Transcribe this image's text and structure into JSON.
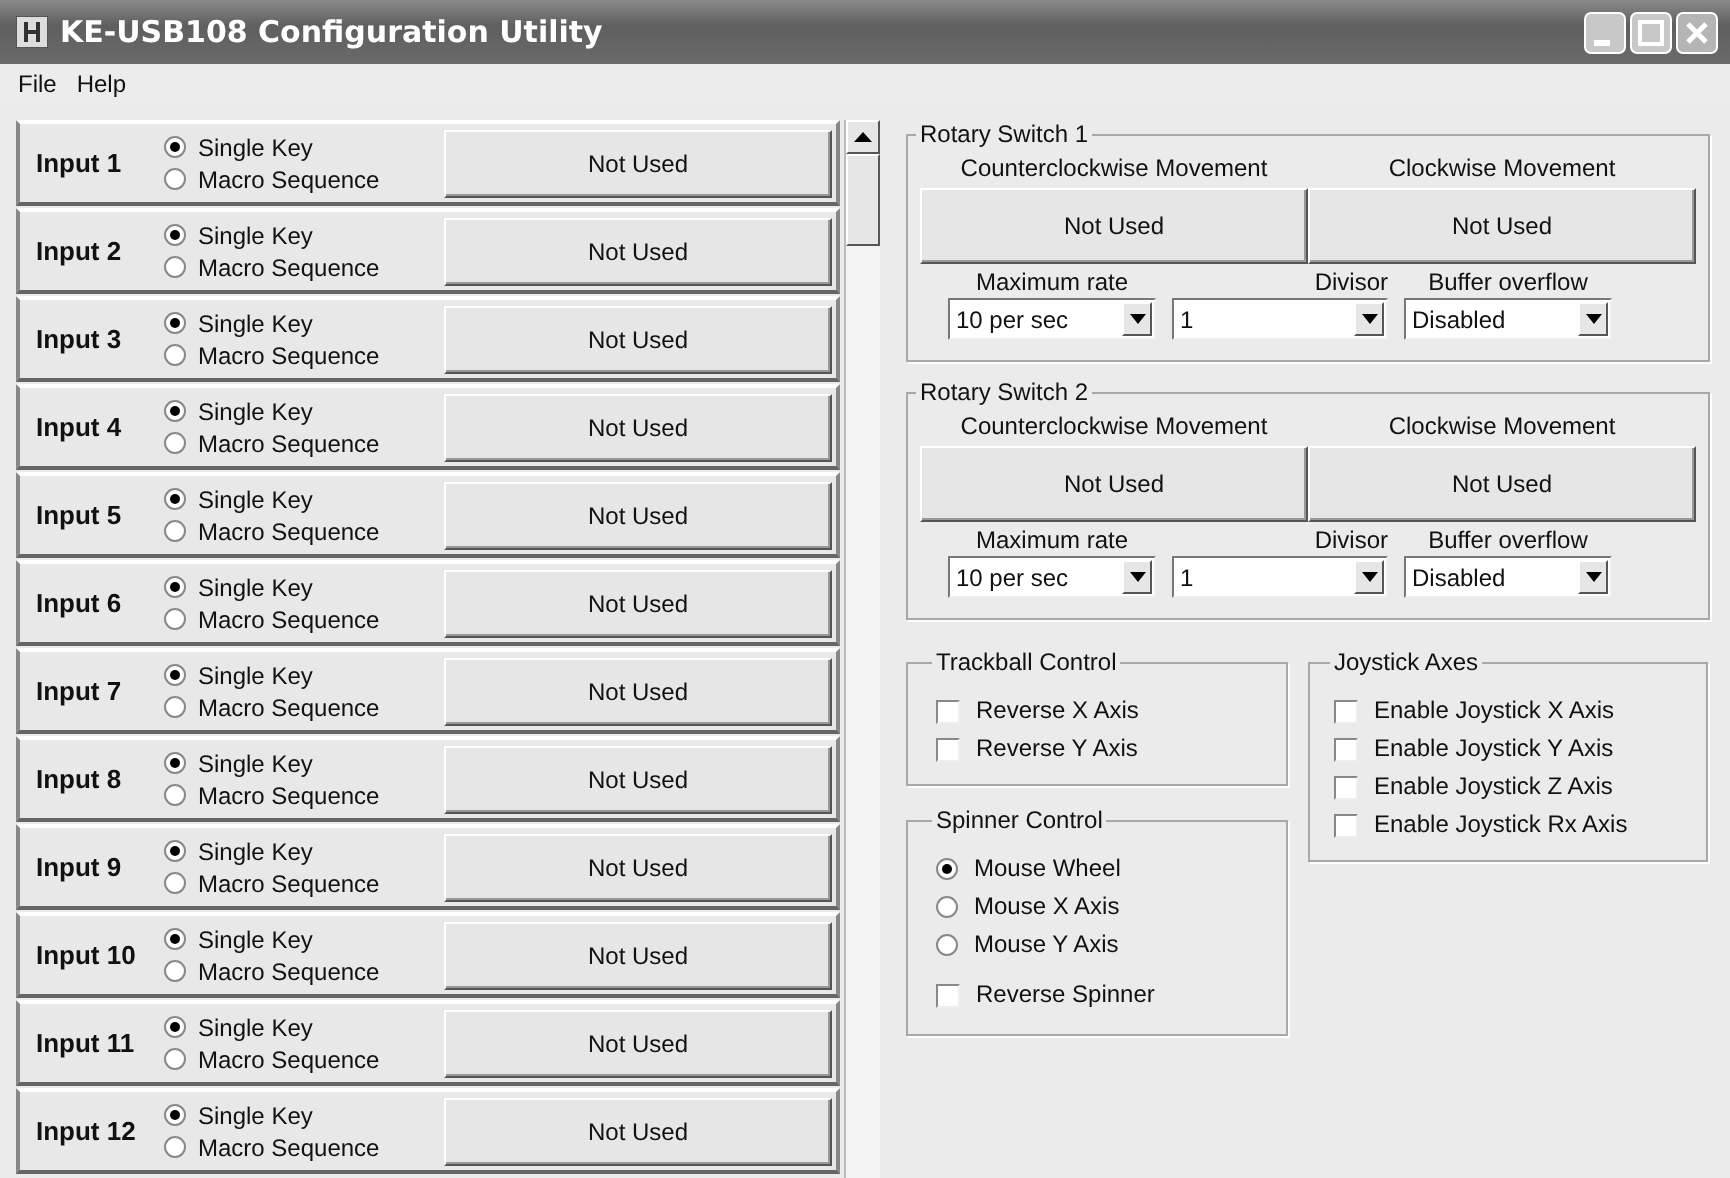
{
  "window": {
    "title": "KE-USB108 Configuration Utility"
  },
  "menu": [
    "File",
    "Help"
  ],
  "inputs": [
    {
      "label": "Input 1",
      "options": [
        {
          "label": "Single Key",
          "selected": true
        },
        {
          "label": "Macro Sequence",
          "selected": false
        }
      ],
      "action": "Not Used"
    },
    {
      "label": "Input 2",
      "options": [
        {
          "label": "Single Key",
          "selected": true
        },
        {
          "label": "Macro Sequence",
          "selected": false
        }
      ],
      "action": "Not Used"
    },
    {
      "label": "Input 3",
      "options": [
        {
          "label": "Single Key",
          "selected": true
        },
        {
          "label": "Macro Sequence",
          "selected": false
        }
      ],
      "action": "Not Used"
    },
    {
      "label": "Input 4",
      "options": [
        {
          "label": "Single Key",
          "selected": true
        },
        {
          "label": "Macro Sequence",
          "selected": false
        }
      ],
      "action": "Not Used"
    },
    {
      "label": "Input 5",
      "options": [
        {
          "label": "Single Key",
          "selected": true
        },
        {
          "label": "Macro Sequence",
          "selected": false
        }
      ],
      "action": "Not Used"
    },
    {
      "label": "Input 6",
      "options": [
        {
          "label": "Single Key",
          "selected": true
        },
        {
          "label": "Macro Sequence",
          "selected": false
        }
      ],
      "action": "Not Used"
    },
    {
      "label": "Input 7",
      "options": [
        {
          "label": "Single Key",
          "selected": true
        },
        {
          "label": "Macro Sequence",
          "selected": false
        }
      ],
      "action": "Not Used"
    },
    {
      "label": "Input 8",
      "options": [
        {
          "label": "Single Key",
          "selected": true
        },
        {
          "label": "Macro Sequence",
          "selected": false
        }
      ],
      "action": "Not Used"
    },
    {
      "label": "Input 9",
      "options": [
        {
          "label": "Single Key",
          "selected": true
        },
        {
          "label": "Macro Sequence",
          "selected": false
        }
      ],
      "action": "Not Used"
    },
    {
      "label": "Input 10",
      "options": [
        {
          "label": "Single Key",
          "selected": true
        },
        {
          "label": "Macro Sequence",
          "selected": false
        }
      ],
      "action": "Not Used"
    },
    {
      "label": "Input 11",
      "options": [
        {
          "label": "Single Key",
          "selected": true
        },
        {
          "label": "Macro Sequence",
          "selected": false
        }
      ],
      "action": "Not Used"
    },
    {
      "label": "Input 12",
      "options": [
        {
          "label": "Single Key",
          "selected": true
        },
        {
          "label": "Macro Sequence",
          "selected": false
        }
      ],
      "action": "Not Used"
    }
  ],
  "rotary_switches": [
    {
      "title": "Rotary Switch 1",
      "movements": [
        {
          "label": "Counterclockwise Movement",
          "value": "Not Used"
        },
        {
          "label": "Clockwise Movement",
          "value": "Not Used"
        }
      ],
      "dropdowns": [
        {
          "label": "Maximum rate",
          "value": "10 per sec"
        },
        {
          "label": "Divisor",
          "value": "1"
        },
        {
          "label": "Buffer overflow",
          "value": "Disabled"
        }
      ]
    },
    {
      "title": "Rotary Switch 2",
      "movements": [
        {
          "label": "Counterclockwise Movement",
          "value": "Not Used"
        },
        {
          "label": "Clockwise Movement",
          "value": "Not Used"
        }
      ],
      "dropdowns": [
        {
          "label": "Maximum rate",
          "value": "10 per sec"
        },
        {
          "label": "Divisor",
          "value": "1"
        },
        {
          "label": "Buffer overflow",
          "value": "Disabled"
        }
      ]
    }
  ],
  "trackball": {
    "title": "Trackball Control",
    "options": [
      {
        "label": "Reverse X Axis",
        "checked": false
      },
      {
        "label": "Reverse Y Axis",
        "checked": false
      }
    ]
  },
  "spinner": {
    "title": "Spinner Control",
    "modes": [
      {
        "label": "Mouse Wheel",
        "selected": true
      },
      {
        "label": "Mouse X Axis",
        "selected": false
      },
      {
        "label": "Mouse Y Axis",
        "selected": false
      }
    ],
    "reverse": {
      "label": "Reverse Spinner",
      "checked": false
    }
  },
  "joystick": {
    "title": "Joystick Axes",
    "options": [
      {
        "label": "Enable Joystick X Axis",
        "checked": false
      },
      {
        "label": "Enable Joystick Y Axis",
        "checked": false
      },
      {
        "label": "Enable Joystick Z Axis",
        "checked": false
      },
      {
        "label": "Enable Joystick Rx Axis",
        "checked": false
      }
    ]
  }
}
